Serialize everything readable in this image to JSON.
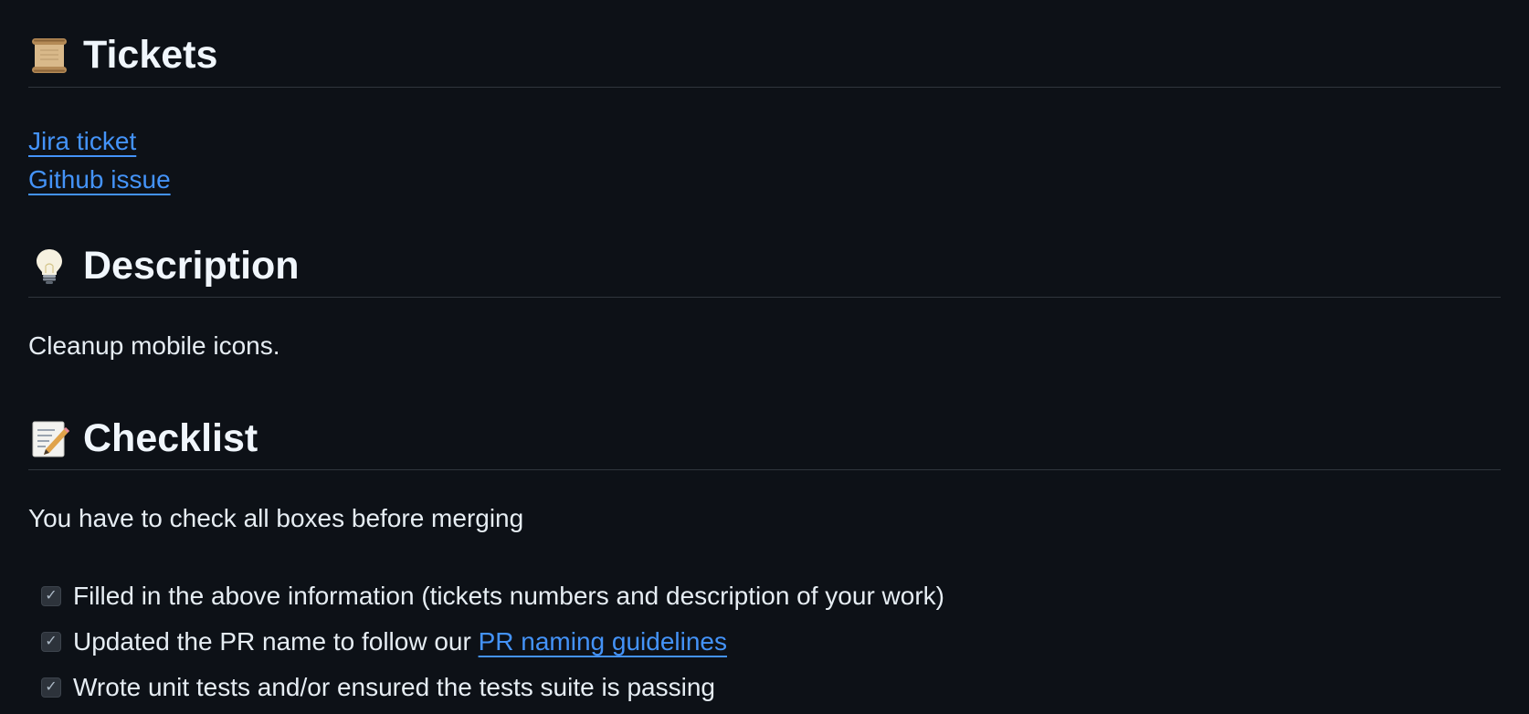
{
  "sections": {
    "tickets": {
      "title": "Tickets",
      "icon": "scroll-icon",
      "links": [
        "Jira ticket",
        "Github issue"
      ]
    },
    "description": {
      "title": "Description",
      "icon": "lightbulb-icon",
      "text": "Cleanup mobile icons."
    },
    "checklist": {
      "title": "Checklist",
      "icon": "memo-icon",
      "intro": "You have to check all boxes before merging",
      "items": [
        {
          "text": "Filled in the above information (tickets numbers and description of your work)",
          "checked": true
        },
        {
          "text_before": "Updated the PR name to follow our ",
          "link": "PR naming guidelines",
          "checked": true
        },
        {
          "text": "Wrote unit tests and/or ensured the tests suite is passing",
          "checked": true
        }
      ]
    }
  },
  "colors": {
    "background": "#0d1117",
    "text": "#e6edf3",
    "link": "#4493f8",
    "divider": "#30363d"
  }
}
